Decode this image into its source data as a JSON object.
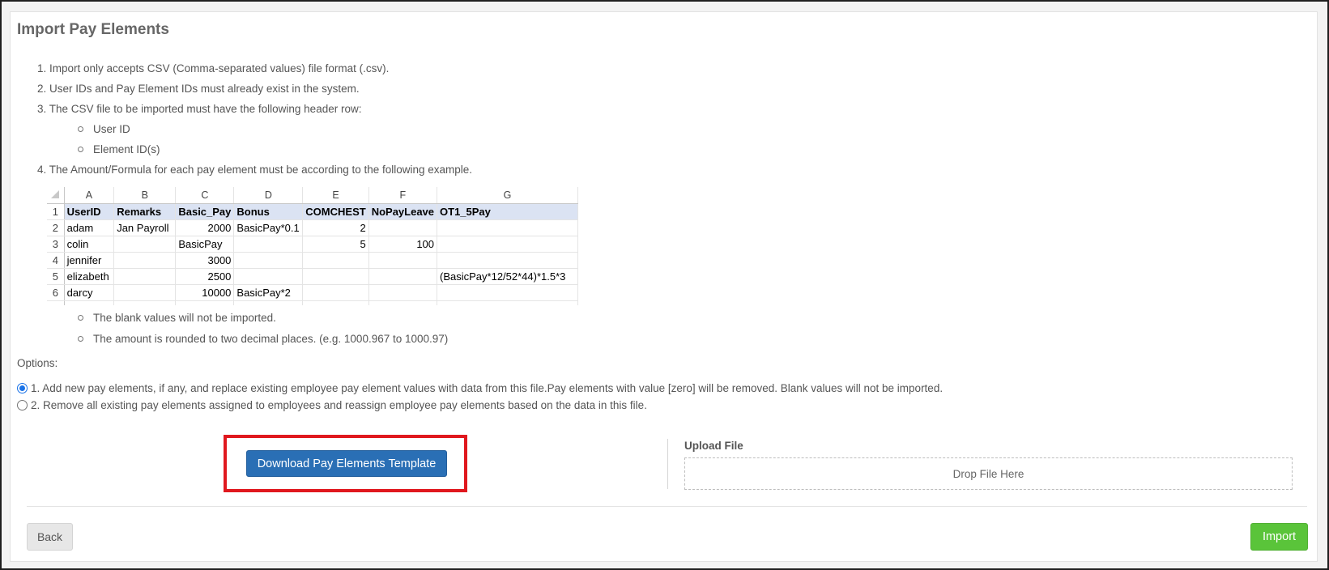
{
  "page": {
    "title": "Import Pay Elements"
  },
  "instructions": [
    "1. Import only accepts CSV (Comma-separated values) file format (.csv).",
    "2. User IDs and Pay Element IDs must already exist in the system.",
    "3. The CSV file to be imported must have the following header row:",
    "4. The Amount/Formula for each pay element must be according to the following example."
  ],
  "header_bullets": [
    "User ID",
    "Element ID(s)"
  ],
  "note_bullets": [
    "The blank values will not be imported.",
    "The amount is rounded to two decimal places. (e.g. 1000.967 to 1000.97)"
  ],
  "spreadsheet": {
    "columns": [
      "A",
      "B",
      "C",
      "D",
      "E",
      "F",
      "G"
    ],
    "row_numbers": [
      "1",
      "2",
      "3",
      "4",
      "5",
      "6"
    ],
    "rows": [
      [
        "UserID",
        "Remarks",
        "Basic_Pay",
        "Bonus",
        "COMCHEST",
        "NoPayLeave",
        "OT1_5Pay"
      ],
      [
        "adam",
        "Jan Payroll",
        "2000",
        "BasicPay*0.1",
        "2",
        "",
        ""
      ],
      [
        "colin",
        "",
        "BasicPay",
        "",
        "5",
        "100",
        ""
      ],
      [
        "jennifer",
        "",
        "3000",
        "",
        "",
        "",
        ""
      ],
      [
        "elizabeth",
        "",
        "2500",
        "",
        "",
        "",
        "(BasicPay*12/52*44)*1.5*3"
      ],
      [
        "darcy",
        "",
        "10000",
        "BasicPay*2",
        "",
        "",
        ""
      ]
    ]
  },
  "options": {
    "label": "Options:",
    "choices": [
      {
        "label": "1. Add new pay elements, if any, and replace existing employee pay element values with data from this file.Pay elements with value [zero] will be removed. Blank values will not be imported.",
        "selected": true
      },
      {
        "label": "2. Remove all existing pay elements assigned to employees and reassign employee pay elements based on the data in this file.",
        "selected": false
      }
    ]
  },
  "download_button": "Download Pay Elements Template",
  "upload": {
    "label": "Upload File",
    "dropzone": "Drop File Here"
  },
  "footer": {
    "back": "Back",
    "import": "Import"
  },
  "colors": {
    "primary": "#2a6fb5",
    "success": "#5ac43a",
    "highlight": "#e0181e",
    "header_fill": "#dbe3f3"
  }
}
